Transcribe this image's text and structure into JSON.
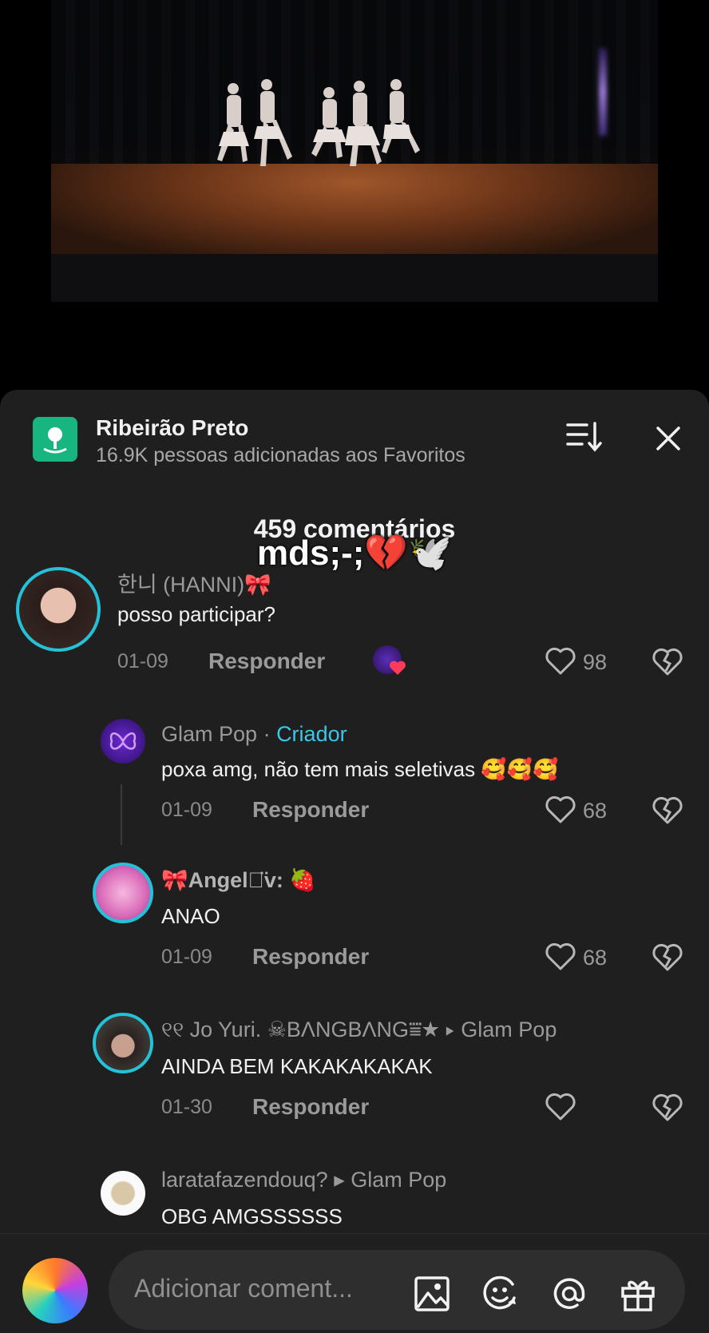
{
  "panel": {
    "place_name": "Ribeirão Preto",
    "favorites_text": "16.9K pessoas adicionadas aos Favoritos",
    "comment_count": "459 comentários",
    "overlay_caption": "mds;-;💔🕊️"
  },
  "comments": [
    {
      "username": "한니 (HANNI)🎀",
      "text": "posso participar?",
      "date": "01-09",
      "reply_label": "Responder",
      "likes": "98",
      "creator_liked": true
    },
    {
      "username": "Glam Pop",
      "separator": " · ",
      "badge": "Criador",
      "text": "poxa amg, não tem mais seletivas 🥰🥰🥰",
      "date": "01-09",
      "reply_label": "Responder",
      "likes": "68"
    },
    {
      "username": "🎀Angel๑̈v: 🍓",
      "text": "ANAO",
      "date": "01-09",
      "reply_label": "Responder",
      "likes": "68"
    },
    {
      "username": "୧୧ Jo Yuri. ☠︎BΛNGBΛNG⩸★",
      "reply_to_arrow": "▸",
      "reply_to": "Glam Pop",
      "text": "AINDA BEM KAKAKAKAKAK",
      "date": "01-30",
      "reply_label": "Responder",
      "likes": ""
    },
    {
      "username": "laratafazendouq?",
      "reply_to_arrow": "▸",
      "reply_to": "Glam Pop",
      "text": "OBG AMGSSSSSS"
    }
  ],
  "composer": {
    "placeholder": "Adicionar coment...",
    "icons": [
      "image-icon",
      "emoji-icon",
      "mention-icon",
      "gift-icon"
    ]
  },
  "colors": {
    "panel_bg": "#1f1f1f",
    "creator_badge": "#3dc6e6",
    "avatar_ring": "#24c2d8",
    "location_icon": "#17b681"
  }
}
